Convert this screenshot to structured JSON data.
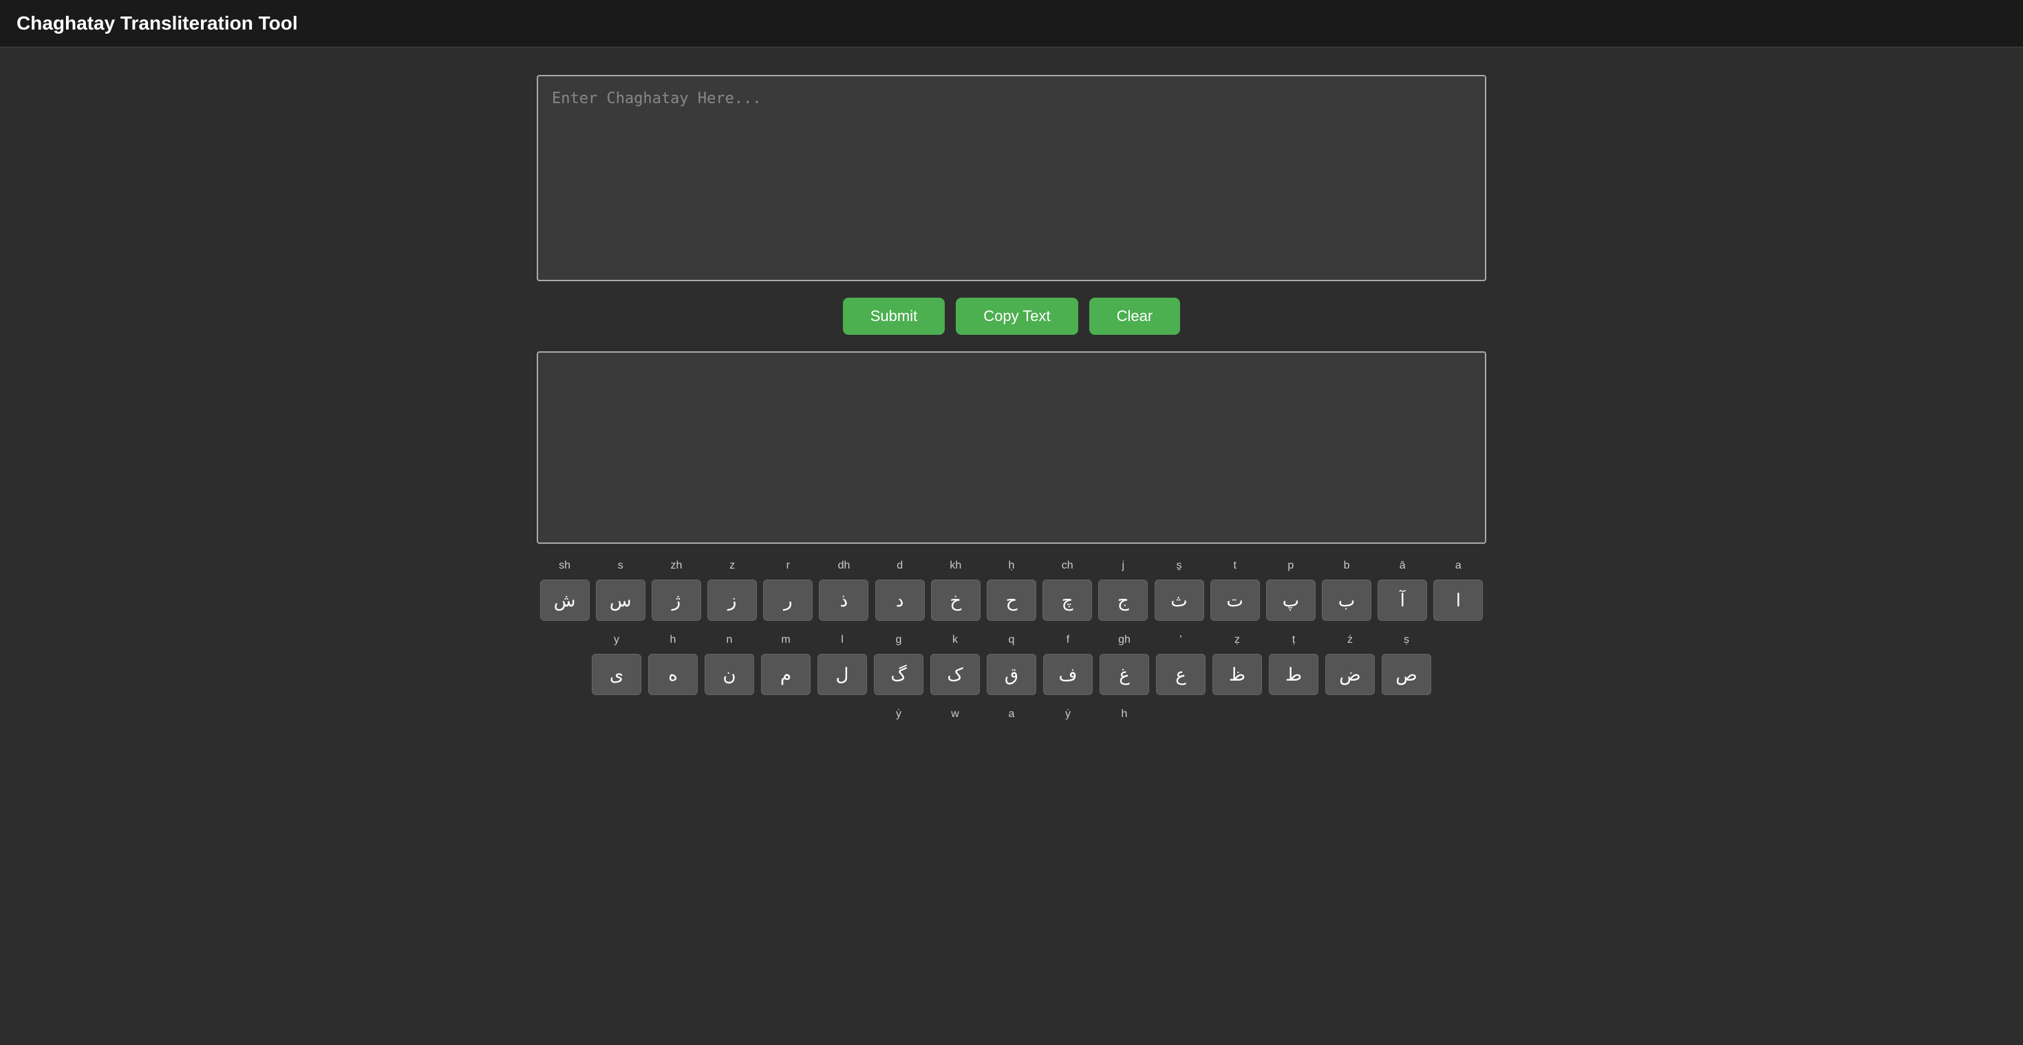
{
  "header": {
    "title": "Chaghatay Transliteration Tool"
  },
  "input": {
    "placeholder": "Enter Chaghatay Here..."
  },
  "buttons": {
    "submit": "Submit",
    "copy_text": "Copy Text",
    "clear": "Clear"
  },
  "keyboard": {
    "row1": [
      {
        "latin": "sh",
        "arabic": "ش"
      },
      {
        "latin": "s",
        "arabic": "س"
      },
      {
        "latin": "zh",
        "arabic": "ژ"
      },
      {
        "latin": "z",
        "arabic": "ز"
      },
      {
        "latin": "r",
        "arabic": "ر"
      },
      {
        "latin": "dh",
        "arabic": "ذ"
      },
      {
        "latin": "d",
        "arabic": "د"
      },
      {
        "latin": "kh",
        "arabic": "خ"
      },
      {
        "latin": "ḥ",
        "arabic": "ح"
      },
      {
        "latin": "ch",
        "arabic": "چ"
      },
      {
        "latin": "j",
        "arabic": "ج"
      },
      {
        "latin": "s̱",
        "arabic": "ث"
      },
      {
        "latin": "t",
        "arabic": "ت"
      },
      {
        "latin": "p",
        "arabic": "پ"
      },
      {
        "latin": "b",
        "arabic": "ب"
      },
      {
        "latin": "ā",
        "arabic": "آ"
      },
      {
        "latin": "a",
        "arabic": "ا"
      }
    ],
    "row2": [
      {
        "latin": "y",
        "arabic": "ی"
      },
      {
        "latin": "h",
        "arabic": "ه"
      },
      {
        "latin": "n",
        "arabic": "ن"
      },
      {
        "latin": "m",
        "arabic": "م"
      },
      {
        "latin": "l",
        "arabic": "ل"
      },
      {
        "latin": "g",
        "arabic": "گ"
      },
      {
        "latin": "k",
        "arabic": "ک"
      },
      {
        "latin": "q",
        "arabic": "ق"
      },
      {
        "latin": "f",
        "arabic": "ف"
      },
      {
        "latin": "gh",
        "arabic": "غ"
      },
      {
        "latin": "'",
        "arabic": "ع"
      },
      {
        "latin": "ẓ",
        "arabic": "ظ"
      },
      {
        "latin": "ṭ",
        "arabic": "ط"
      },
      {
        "latin": "ż",
        "arabic": "ض"
      },
      {
        "latin": "ṣ",
        "arabic": "ص"
      }
    ],
    "row3_labels": [
      {
        "latin": "ẏ",
        "arabic": ""
      },
      {
        "latin": "w",
        "arabic": ""
      },
      {
        "latin": "a",
        "arabic": ""
      },
      {
        "latin": "ẏ",
        "arabic": ""
      },
      {
        "latin": "h",
        "arabic": ""
      }
    ]
  }
}
